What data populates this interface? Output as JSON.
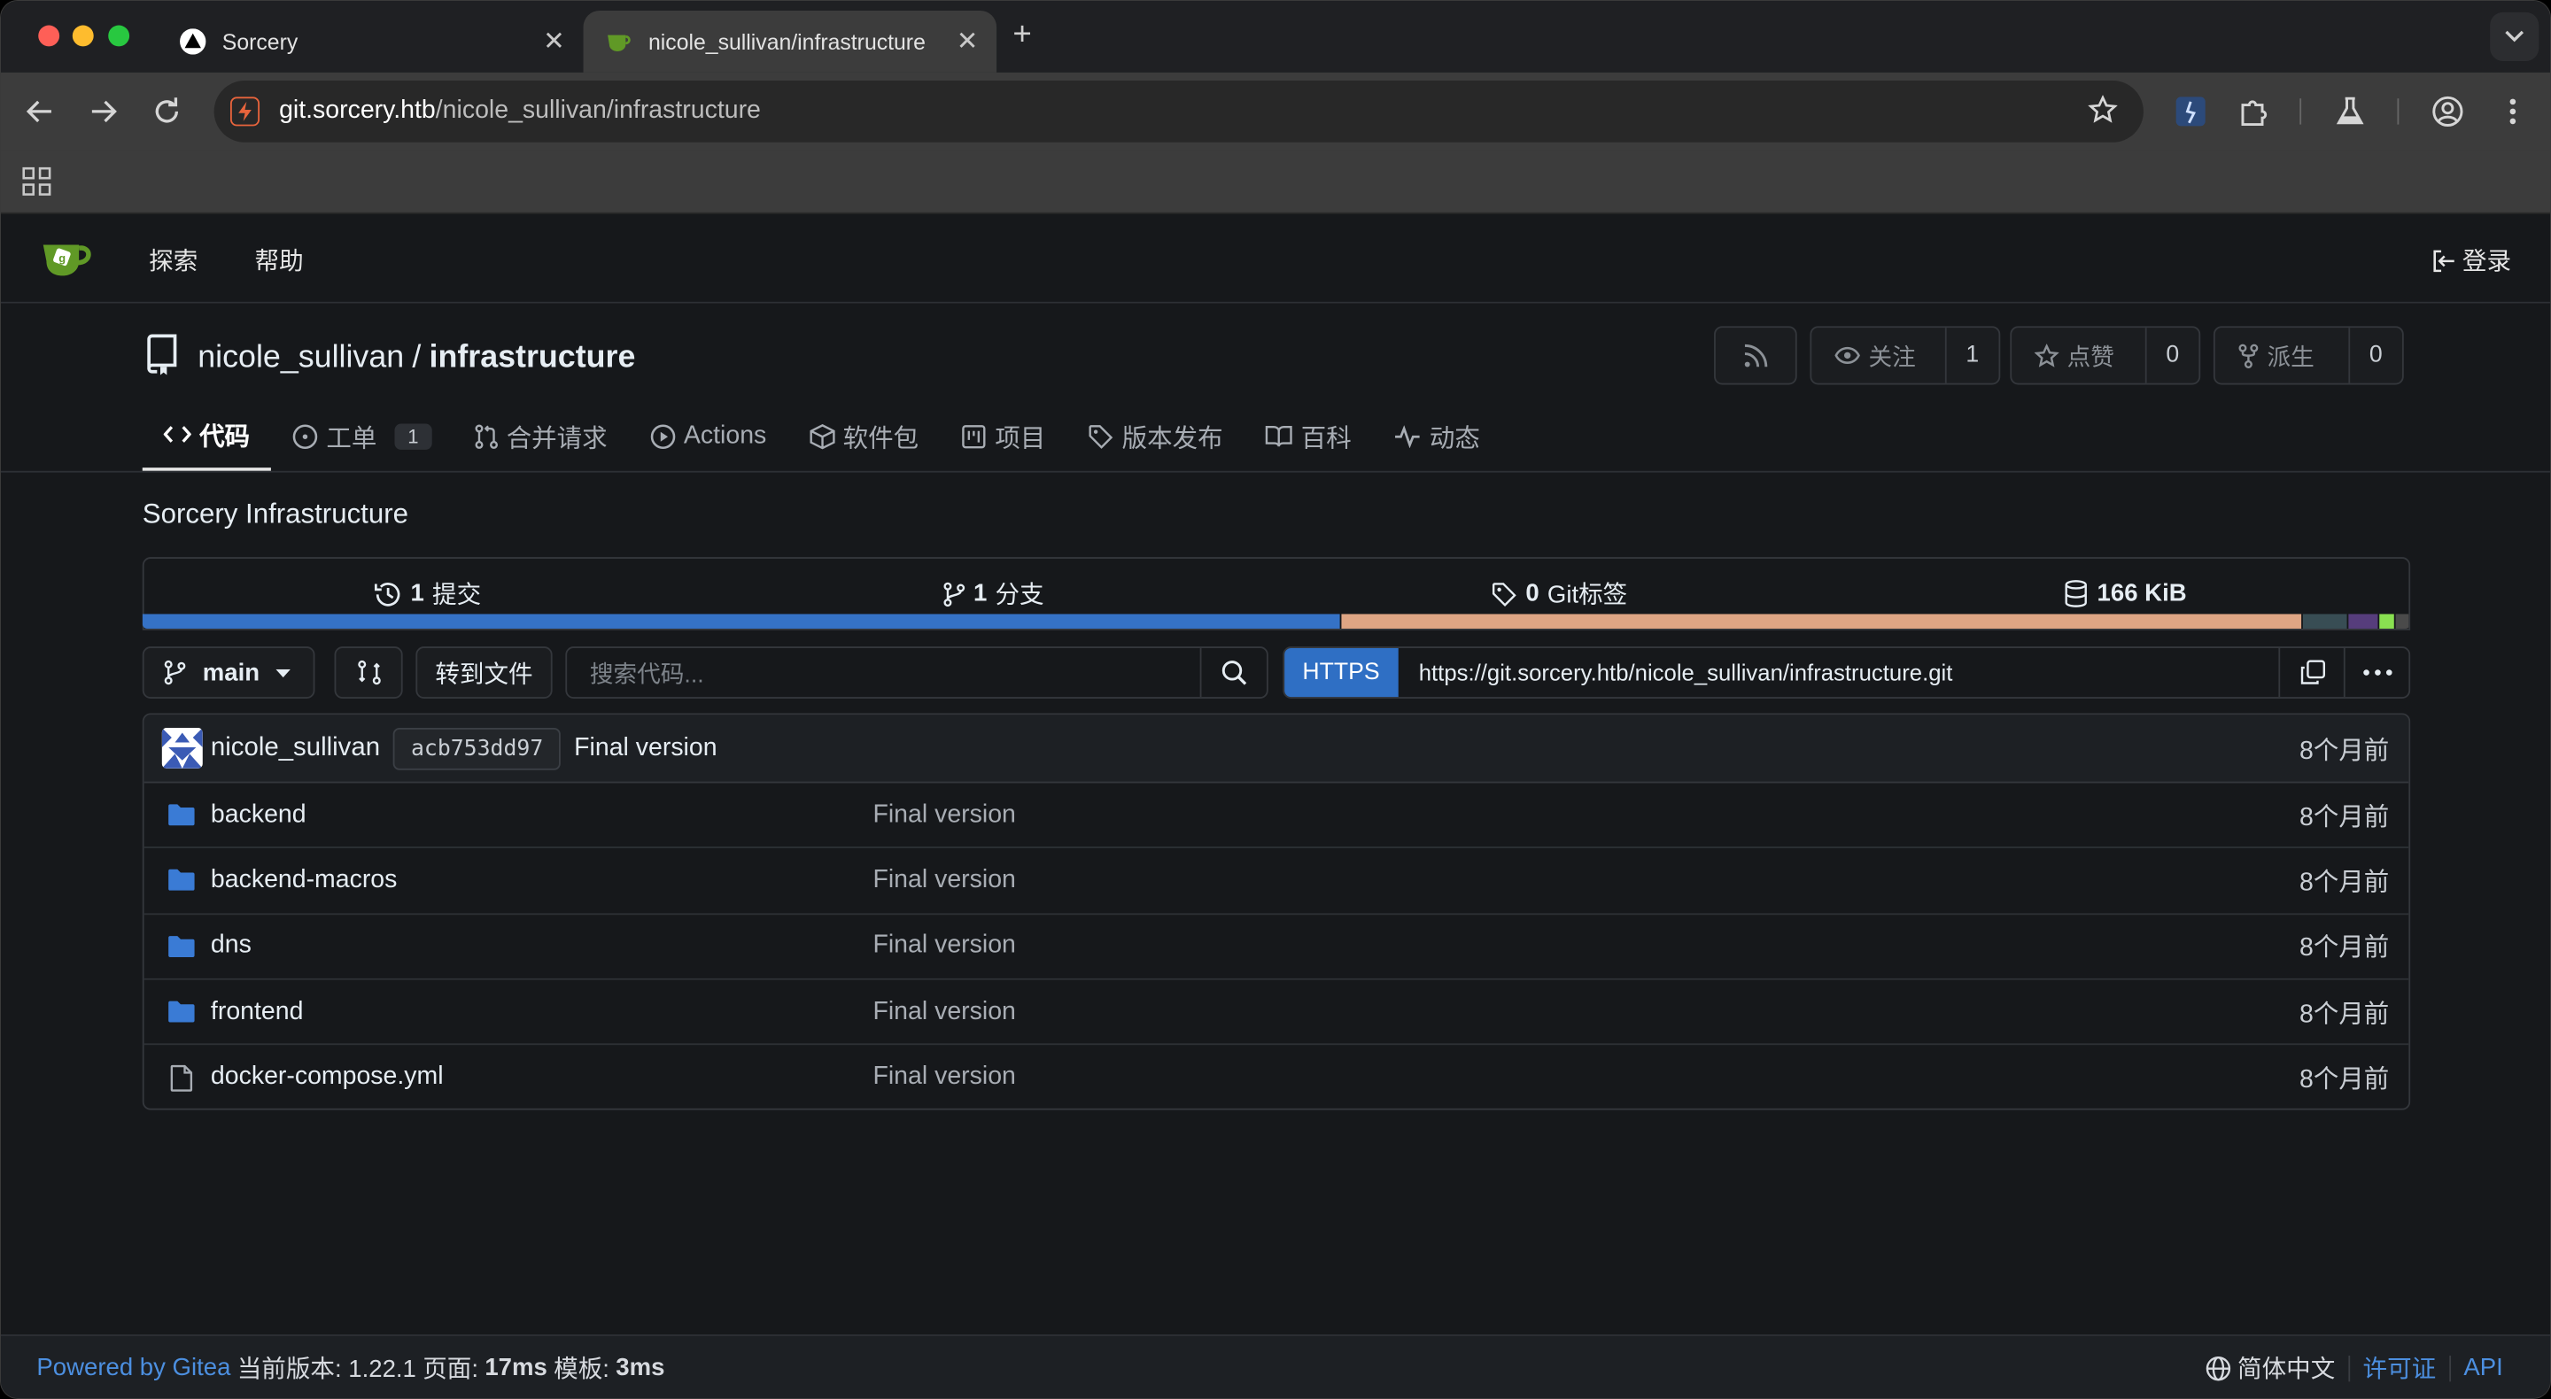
{
  "browser": {
    "tabs": [
      {
        "title": "Sorcery",
        "close": "✕"
      },
      {
        "title": "nicole_sullivan/infrastructure",
        "close": "✕"
      }
    ],
    "new_tab": "+",
    "url_host": "git.sorcery.htb",
    "url_path": "/nicole_sullivan/infrastructure"
  },
  "gitea_nav": {
    "explore": "探索",
    "help": "帮助",
    "login": "登录"
  },
  "repo": {
    "owner": "nicole_sullivan",
    "separator": "/",
    "name": "infrastructure",
    "watch_label": "关注",
    "watch_count": "1",
    "star_label": "点赞",
    "star_count": "0",
    "fork_label": "派生",
    "fork_count": "0",
    "description": "Sorcery Infrastructure"
  },
  "tabs": [
    {
      "label": "代码"
    },
    {
      "label": "工单",
      "badge": "1"
    },
    {
      "label": "合并请求"
    },
    {
      "label": "Actions"
    },
    {
      "label": "软件包"
    },
    {
      "label": "项目"
    },
    {
      "label": "版本发布"
    },
    {
      "label": "百科"
    },
    {
      "label": "动态"
    }
  ],
  "stats": {
    "commits_num": "1",
    "commits_label": "提交",
    "branches_num": "1",
    "branches_label": "分支",
    "tags_num": "0",
    "tags_label": "Git标签",
    "size": "166 KiB"
  },
  "languages": [
    {
      "color": "#3572c6",
      "share": 53
    },
    {
      "color": "#dea584",
      "share": 42.5
    },
    {
      "color": "#384d54",
      "share": 2
    },
    {
      "color": "#563d7c",
      "share": 1.3
    },
    {
      "color": "#89e051",
      "share": 0.6
    },
    {
      "color": "#4a4a4a",
      "share": 0.6
    }
  ],
  "branch": {
    "current": "main",
    "go_to_file": "转到文件",
    "search_placeholder": "搜索代码...",
    "clone_protocol": "HTTPS",
    "clone_url": "https://git.sorcery.htb/nicole_sullivan/infrastructure.git"
  },
  "latest_commit": {
    "author": "nicole_sullivan",
    "sha": "acb753dd97",
    "message": "Final version",
    "time": "8个月前"
  },
  "files": [
    {
      "name": "backend",
      "type": "folder",
      "message": "Final version",
      "time": "8个月前"
    },
    {
      "name": "backend-macros",
      "type": "folder",
      "message": "Final version",
      "time": "8个月前"
    },
    {
      "name": "dns",
      "type": "folder",
      "message": "Final version",
      "time": "8个月前"
    },
    {
      "name": "frontend",
      "type": "folder",
      "message": "Final version",
      "time": "8个月前"
    },
    {
      "name": "docker-compose.yml",
      "type": "file",
      "message": "Final version",
      "time": "8个月前"
    }
  ],
  "footer": {
    "powered": "Powered by Gitea",
    "version_label": "当前版本: 1.22.1",
    "page_label": "页面:",
    "page_time": "17ms",
    "template_label": "模板:",
    "template_time": "3ms",
    "language": "简体中文",
    "license": "许可证",
    "api": "API"
  }
}
